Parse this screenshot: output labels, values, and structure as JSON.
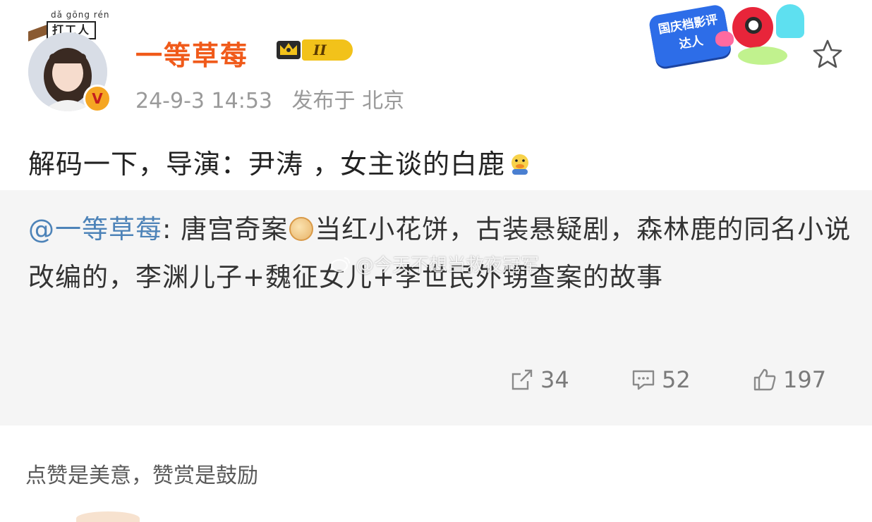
{
  "header": {
    "worker_tag_pinyin": "dǎ gōng rén",
    "worker_tag_text": "打工人",
    "verify_mark": "V",
    "username": "一等草莓",
    "level": "II",
    "timestamp": "24-9-3 14:53",
    "location": "发布于 北京",
    "promo_badge_text": "国庆档影评达人",
    "favorite_icon": "star-outline-icon"
  },
  "post": {
    "text": "解码一下，导演：尹涛 ，女主谈的白鹿",
    "emoji": "duck-emoji"
  },
  "repost": {
    "mention": "@一等草莓",
    "text_before_emoji": ": 唐宫奇案",
    "emoji": "mooncake-emoji",
    "text_after_emoji": "当红小花饼，古装悬疑剧，森林鹿的同名小说改编的，李渊儿子+魏征女儿+李世民外甥查案的故事",
    "watermark": "@今天不想当救夜冠军",
    "stats": {
      "reposts": "34",
      "comments": "52",
      "likes": "197"
    }
  },
  "footer": {
    "reward_text": "点赞是美意，赞赏是鼓励"
  },
  "colors": {
    "username": "#f05a1a",
    "mention": "#4d83b8",
    "meta": "#9a9a9a",
    "repost_bg": "#f5f5f5"
  }
}
